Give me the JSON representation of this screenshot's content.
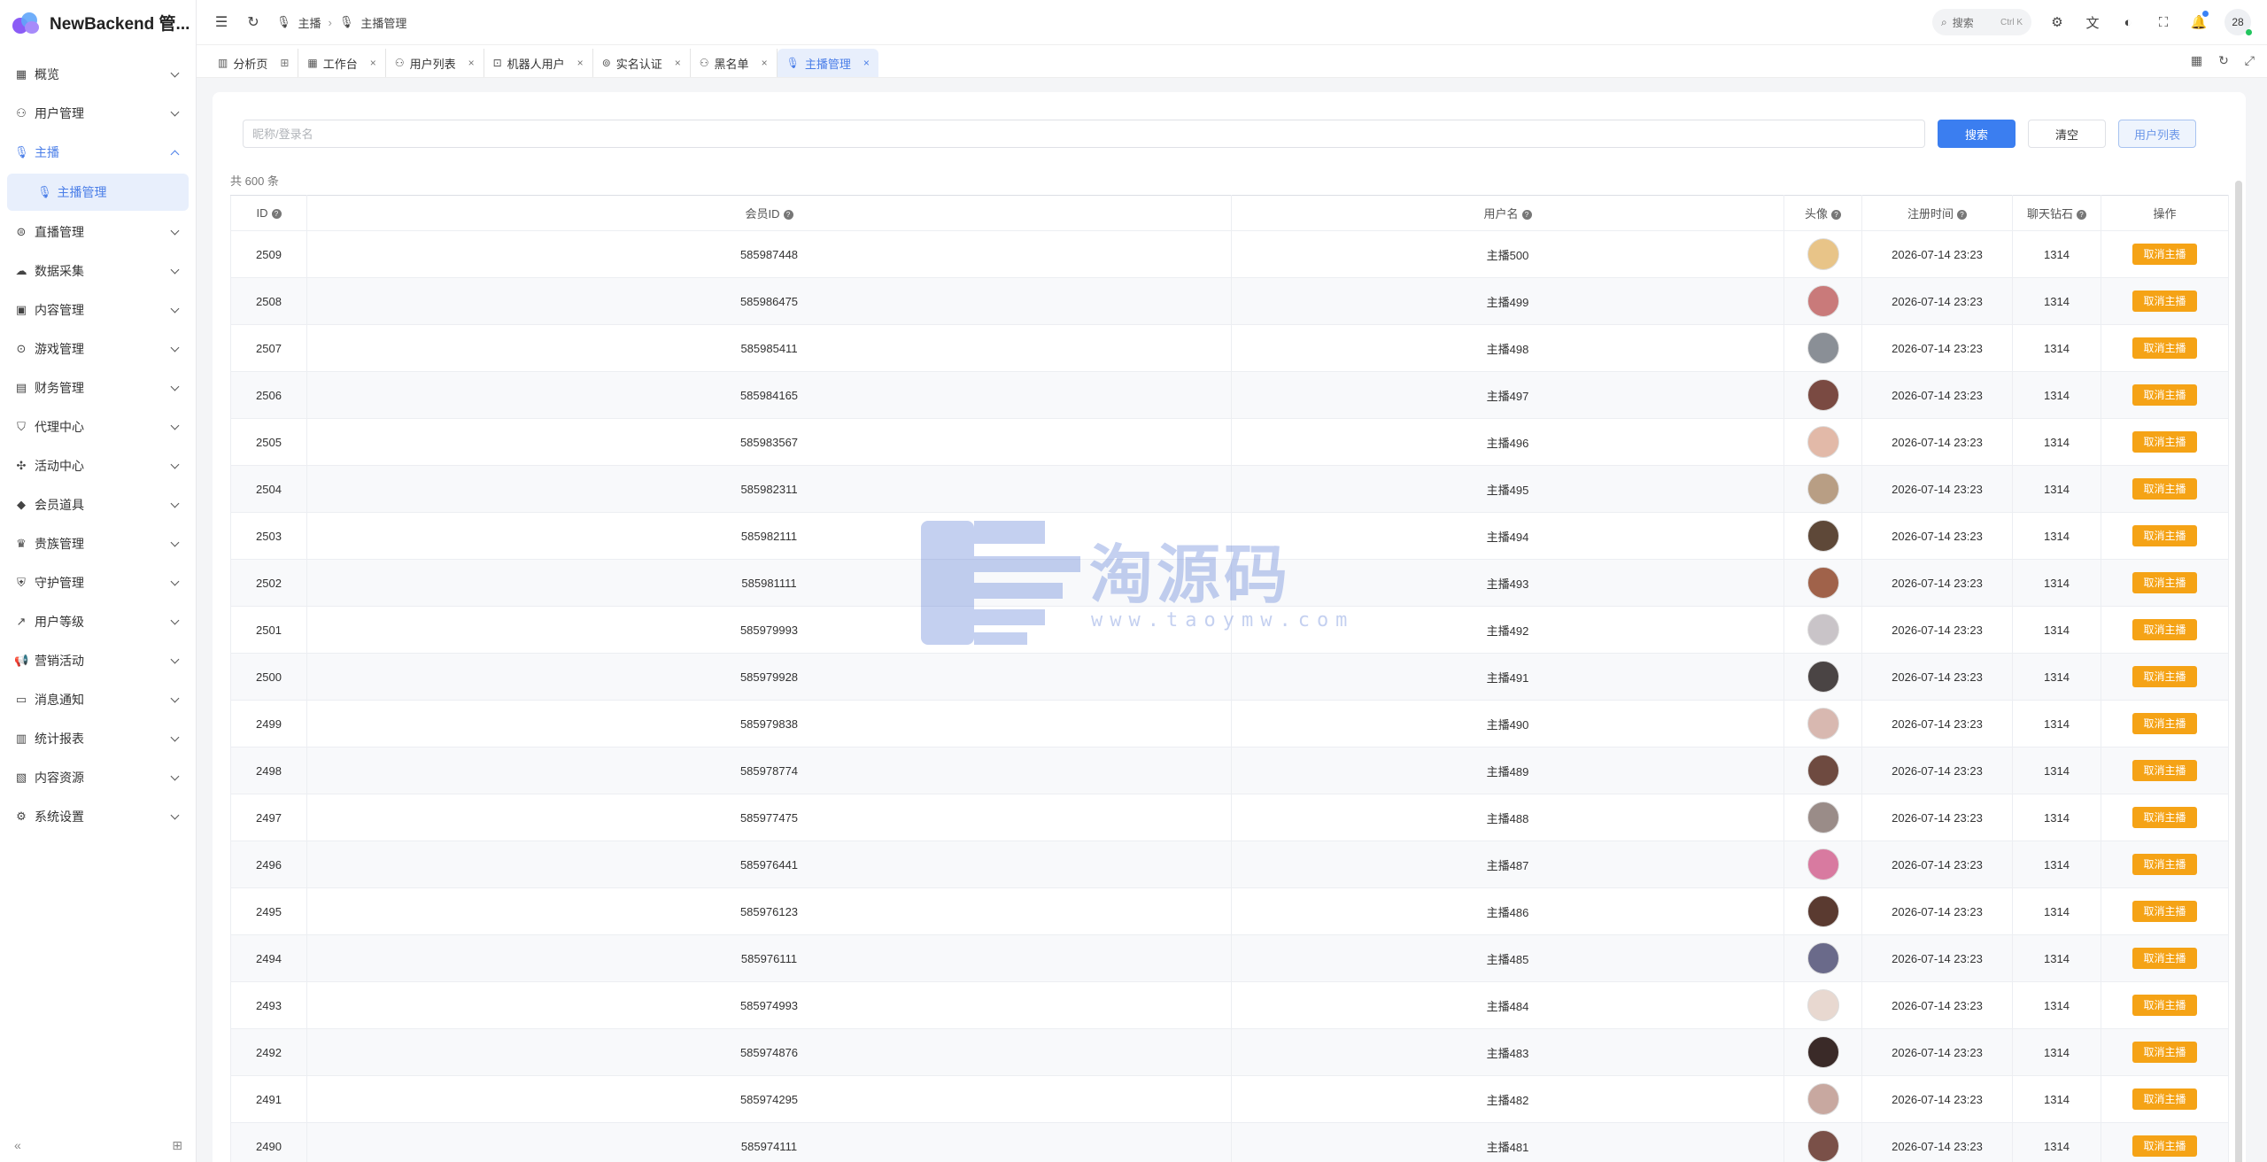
{
  "app": {
    "title": "NewBackend 管..."
  },
  "sidebar": {
    "items": [
      {
        "label": "概览",
        "icon": "▦",
        "active": false
      },
      {
        "label": "用户管理",
        "icon": "⚇",
        "active": false
      },
      {
        "label": "主播",
        "icon": "🎙",
        "active": true,
        "expanded": true
      },
      {
        "label": "直播管理",
        "icon": "⊜",
        "active": false
      },
      {
        "label": "数据采集",
        "icon": "☁",
        "active": false
      },
      {
        "label": "内容管理",
        "icon": "▣",
        "active": false
      },
      {
        "label": "游戏管理",
        "icon": "⊙",
        "active": false
      },
      {
        "label": "财务管理",
        "icon": "▤",
        "active": false
      },
      {
        "label": "代理中心",
        "icon": "⛉",
        "active": false
      },
      {
        "label": "活动中心",
        "icon": "✣",
        "active": false
      },
      {
        "label": "会员道具",
        "icon": "◆",
        "active": false
      },
      {
        "label": "贵族管理",
        "icon": "♛",
        "active": false
      },
      {
        "label": "守护管理",
        "icon": "⛨",
        "active": false
      },
      {
        "label": "用户等级",
        "icon": "↗",
        "active": false
      },
      {
        "label": "营销活动",
        "icon": "📢",
        "active": false
      },
      {
        "label": "消息通知",
        "icon": "▭",
        "active": false
      },
      {
        "label": "统计报表",
        "icon": "▥",
        "active": false
      },
      {
        "label": "内容资源",
        "icon": "▧",
        "active": false
      },
      {
        "label": "系统设置",
        "icon": "⚙",
        "active": false
      }
    ],
    "submenu": {
      "label": "主播管理",
      "icon": "🎙"
    },
    "collapse_icon": "«",
    "pin_icon": "⊞"
  },
  "topbar": {
    "breadcrumb": [
      "主播",
      "主播管理"
    ],
    "search_label": "搜索",
    "search_kbd": "Ctrl K",
    "avatar_text": "28"
  },
  "tabs": [
    {
      "label": "分析页",
      "icon": "▥",
      "close": "⊞",
      "active": false
    },
    {
      "label": "工作台",
      "icon": "▦",
      "close": "×",
      "active": false
    },
    {
      "label": "用户列表",
      "icon": "⚇",
      "close": "×",
      "active": false
    },
    {
      "label": "机器人用户",
      "icon": "⊡",
      "close": "×",
      "active": false
    },
    {
      "label": "实名认证",
      "icon": "⊚",
      "close": "×",
      "active": false
    },
    {
      "label": "黑名单",
      "icon": "⚇",
      "close": "×",
      "active": false
    },
    {
      "label": "主播管理",
      "icon": "🎙",
      "close": "×",
      "active": true
    }
  ],
  "filter": {
    "placeholder": "昵称/登录名",
    "search_label": "搜索",
    "clear_label": "清空",
    "userlist_label": "用户列表"
  },
  "total_text": "共 600 条",
  "table": {
    "columns": [
      "ID",
      "会员ID",
      "用户名",
      "头像",
      "注册时间",
      "聊天钻石",
      "操作"
    ],
    "action_label": "取消主播",
    "rows": [
      {
        "id": "2509",
        "member_id": "585987448",
        "username": "主播500",
        "time": "2026-07-14 23:23",
        "diamonds": "1314",
        "avatar_color": "#e8c488"
      },
      {
        "id": "2508",
        "member_id": "585986475",
        "username": "主播499",
        "time": "2026-07-14 23:23",
        "diamonds": "1314",
        "avatar_color": "#c97a7a"
      },
      {
        "id": "2507",
        "member_id": "585985411",
        "username": "主播498",
        "time": "2026-07-14 23:23",
        "diamonds": "1314",
        "avatar_color": "#8a8f96"
      },
      {
        "id": "2506",
        "member_id": "585984165",
        "username": "主播497",
        "time": "2026-07-14 23:23",
        "diamonds": "1314",
        "avatar_color": "#7a4a42"
      },
      {
        "id": "2505",
        "member_id": "585983567",
        "username": "主播496",
        "time": "2026-07-14 23:23",
        "diamonds": "1314",
        "avatar_color": "#e2b9a8"
      },
      {
        "id": "2504",
        "member_id": "585982311",
        "username": "主播495",
        "time": "2026-07-14 23:23",
        "diamonds": "1314",
        "avatar_color": "#b89e84"
      },
      {
        "id": "2503",
        "member_id": "585982111",
        "username": "主播494",
        "time": "2026-07-14 23:23",
        "diamonds": "1314",
        "avatar_color": "#5e4838"
      },
      {
        "id": "2502",
        "member_id": "585981111",
        "username": "主播493",
        "time": "2026-07-14 23:23",
        "diamonds": "1314",
        "avatar_color": "#a0624a"
      },
      {
        "id": "2501",
        "member_id": "585979993",
        "username": "主播492",
        "time": "2026-07-14 23:23",
        "diamonds": "1314",
        "avatar_color": "#c9c4c8"
      },
      {
        "id": "2500",
        "member_id": "585979928",
        "username": "主播491",
        "time": "2026-07-14 23:23",
        "diamonds": "1314",
        "avatar_color": "#4a4444"
      },
      {
        "id": "2499",
        "member_id": "585979838",
        "username": "主播490",
        "time": "2026-07-14 23:23",
        "diamonds": "1314",
        "avatar_color": "#d8b8b0"
      },
      {
        "id": "2498",
        "member_id": "585978774",
        "username": "主播489",
        "time": "2026-07-14 23:23",
        "diamonds": "1314",
        "avatar_color": "#6e4a40"
      },
      {
        "id": "2497",
        "member_id": "585977475",
        "username": "主播488",
        "time": "2026-07-14 23:23",
        "diamonds": "1314",
        "avatar_color": "#9a8c88"
      },
      {
        "id": "2496",
        "member_id": "585976441",
        "username": "主播487",
        "time": "2026-07-14 23:23",
        "diamonds": "1314",
        "avatar_color": "#d87aa0"
      },
      {
        "id": "2495",
        "member_id": "585976123",
        "username": "主播486",
        "time": "2026-07-14 23:23",
        "diamonds": "1314",
        "avatar_color": "#5a3a30"
      },
      {
        "id": "2494",
        "member_id": "585976111",
        "username": "主播485",
        "time": "2026-07-14 23:23",
        "diamonds": "1314",
        "avatar_color": "#6a6a8a"
      },
      {
        "id": "2493",
        "member_id": "585974993",
        "username": "主播484",
        "time": "2026-07-14 23:23",
        "diamonds": "1314",
        "avatar_color": "#e8d8d0"
      },
      {
        "id": "2492",
        "member_id": "585974876",
        "username": "主播483",
        "time": "2026-07-14 23:23",
        "diamonds": "1314",
        "avatar_color": "#3a2a28"
      },
      {
        "id": "2491",
        "member_id": "585974295",
        "username": "主播482",
        "time": "2026-07-14 23:23",
        "diamonds": "1314",
        "avatar_color": "#c8a8a0"
      },
      {
        "id": "2490",
        "member_id": "585974111",
        "username": "主播481",
        "time": "2026-07-14 23:23",
        "diamonds": "1314",
        "avatar_color": "#7a5048"
      }
    ]
  },
  "watermark": {
    "text": "淘源码",
    "url": "www.taoymw.com"
  },
  "colors": {
    "accent": "#3b7ef0",
    "action": "#f5a316"
  }
}
